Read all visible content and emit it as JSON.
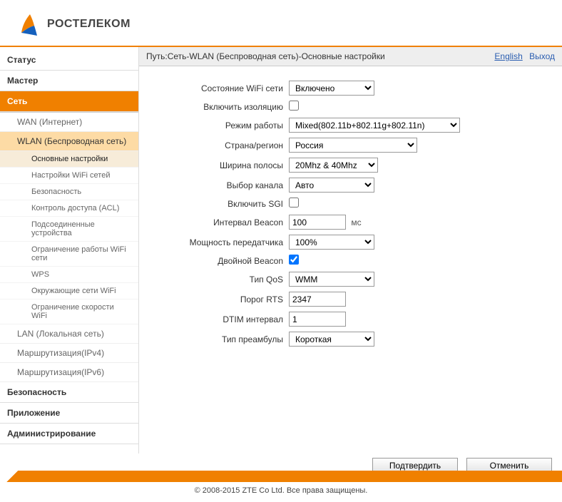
{
  "brand": "РОСТЕЛЕКОМ",
  "breadcrumb": "Путь:Сеть-WLAN (Беспроводная сеть)-Основные настройки",
  "links": {
    "english": "English",
    "logout": "Выход"
  },
  "nav": {
    "status": "Статус",
    "wizard": "Мастер",
    "network": "Сеть",
    "wan": "WAN (Интернет)",
    "wlan": "WLAN (Беспроводная сеть)",
    "wlan_sub": {
      "basic": "Основные настройки",
      "ssid": "Настройки WiFi сетей",
      "security": "Безопасность",
      "acl": "Контроль доступа (ACL)",
      "assoc": "Подсоединенные устройства",
      "limit": "Ограничение работы WiFi сети",
      "wps": "WPS",
      "neighbor": "Окружающие сети WiFi",
      "speed": "Ограничение скорости WiFi"
    },
    "lan": "LAN (Локальная сеть)",
    "route4": "Маршрутизация(IPv4)",
    "route6": "Маршрутизация(IPv6)",
    "sec": "Безопасность",
    "app": "Приложение",
    "admin": "Администрирование"
  },
  "form": {
    "state_label": "Состояние WiFi сети",
    "state_value": "Включено",
    "isolate_label": "Включить изоляцию",
    "mode_label": "Режим работы",
    "mode_value": "Mixed(802.11b+802.11g+802.11n)",
    "country_label": "Страна/регион",
    "country_value": "Россия",
    "bandwidth_label": "Ширина полосы",
    "bandwidth_value": "20Mhz & 40Mhz",
    "channel_label": "Выбор канала",
    "channel_value": "Авто",
    "sgi_label": "Включить SGI",
    "beacon_label": "Интервал Beacon",
    "beacon_value": "100",
    "beacon_unit": "мс",
    "power_label": "Мощность передатчика",
    "power_value": "100%",
    "double_beacon_label": "Двойной Beacon",
    "qos_label": "Тип QoS",
    "qos_value": "WMM",
    "rts_label": "Порог RTS",
    "rts_value": "2347",
    "dtim_label": "DTIM интервал",
    "dtim_value": "1",
    "preamble_label": "Тип преамбулы",
    "preamble_value": "Короткая"
  },
  "buttons": {
    "submit": "Подтвердить",
    "cancel": "Отменить"
  },
  "copyright": "© 2008-2015 ZTE Co Ltd. Все права защищены."
}
